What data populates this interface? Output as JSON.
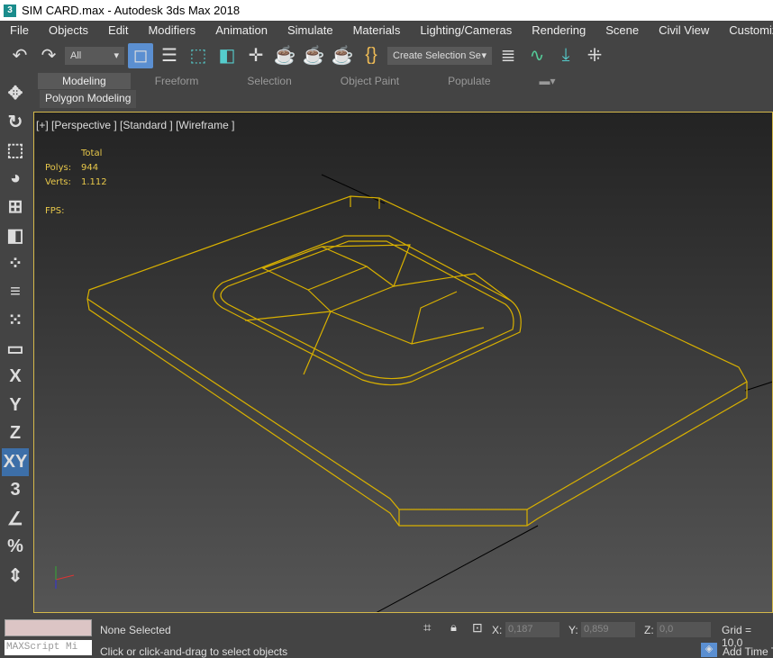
{
  "title": "SIM CARD.max - Autodesk 3ds Max 2018",
  "menu": [
    "File",
    "Objects",
    "Edit",
    "Modifiers",
    "Animation",
    "Simulate",
    "Materials",
    "Lighting/Cameras",
    "Rendering",
    "Scene",
    "Civil View",
    "Customize"
  ],
  "toolbar": {
    "filter": "All",
    "selection_set": "Create Selection Se"
  },
  "ribbon": {
    "tabs": [
      "Modeling",
      "Freeform",
      "Selection",
      "Object Paint",
      "Populate"
    ],
    "panel": "Polygon Modeling"
  },
  "left_tools": [
    "X",
    "Y",
    "Z",
    "XY"
  ],
  "viewport": {
    "label": "[+] [Perspective ] [Standard ] [Wireframe ]",
    "stats": {
      "header": "Total",
      "polys_label": "Polys:",
      "polys": "944",
      "verts_label": "Verts:",
      "verts": "1.112",
      "fps_label": "FPS:"
    },
    "wire_color": "#e0b000"
  },
  "status": {
    "selection": "None Selected",
    "prompt": "Click or click-and-drag to select objects",
    "maxscript": "MAXScript Mi",
    "x_label": "X:",
    "x": "0,187",
    "y_label": "Y:",
    "y": "0,859",
    "z_label": "Z:",
    "z": "0,0",
    "grid": "Grid = 10,0",
    "add_time_tag": "Add Time Ta"
  }
}
